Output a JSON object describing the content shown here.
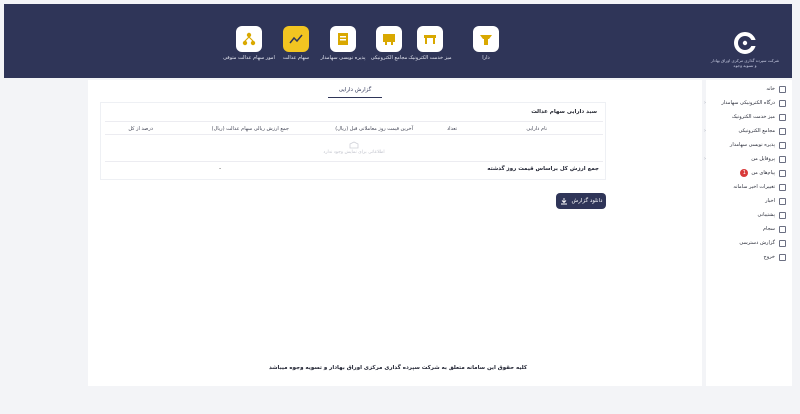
{
  "header": {
    "logo_text": "شرکت سپرده گذاری مرکزی اوراق بهادار و تسویه وجوه",
    "nav": [
      {
        "label": "دارا",
        "icon": "dara-icon"
      },
      {
        "label": "میز خدمت الکترونیک",
        "icon": "desk-icon"
      },
      {
        "label": "مجامع الکترونیکی",
        "icon": "meeting-icon"
      },
      {
        "label": "پذیره نویسی سهامدار",
        "icon": "subscription-icon"
      },
      {
        "label": "سهام عدالت",
        "icon": "chart-icon"
      },
      {
        "label": "امور سهام عدالت متوفی",
        "icon": "network-icon"
      }
    ]
  },
  "sidebar": {
    "items": [
      {
        "label": "خانه"
      },
      {
        "label": "درگاه الکترونیکی سهامدار"
      },
      {
        "label": "میز خدمت الکترونیک"
      },
      {
        "label": "مجامع الکترونیکی"
      },
      {
        "label": "پذیره نویسی سهامدار"
      },
      {
        "label": "پروفایل من"
      },
      {
        "label": "پیام‌های من",
        "badge": "1"
      },
      {
        "label": "تغییرات اخیر سامانه"
      },
      {
        "label": "اخبار"
      },
      {
        "label": "پشتیبانی"
      },
      {
        "label": "سجام"
      },
      {
        "label": "گزارش دسترسی"
      },
      {
        "label": "خروج"
      }
    ]
  },
  "main": {
    "tab_label": "گزارش دارایی",
    "panel_title": "سبد دارایی سهام عدالت",
    "columns": [
      "نام دارایی",
      "تعداد",
      "آخرین قیمت روز معاملاتی قبل (ریال)",
      "جمع ارزش ریالی سهام عدالت (ریال)",
      "درصد از کل"
    ],
    "empty_text": "اطلاعاتی برای نمایش وجود ندارد",
    "total_label": "جمع ارزش کل براساس قیمت روز گذشته",
    "total_value": "-",
    "download_label": "دانلود گزارش",
    "footer": "کلیه حقوق این سامانه متعلق به شرکت سپرده گذاری مرکزی اوراق بهادار و تسویه وجوه میباشد"
  },
  "colors": {
    "header": "#2f3558",
    "accent": "#f2c521",
    "badge": "#d83a3a"
  }
}
